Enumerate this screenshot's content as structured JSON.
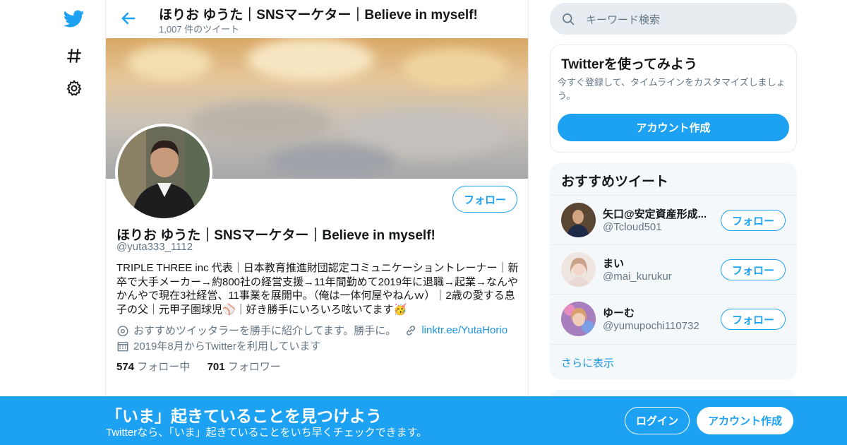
{
  "colors": {
    "brand": "#1da1f2",
    "link": "#1b95e0",
    "muted": "#657786",
    "border": "#e6ecf0"
  },
  "nav": {
    "icons": [
      "twitter-bird-icon",
      "hashtag-icon",
      "gear-icon"
    ]
  },
  "header": {
    "title": "ほりお ゆうた｜SNSマーケター｜Believe in myself!",
    "tweet_count": "1,007 件のツイート"
  },
  "profile": {
    "follow_label": "フォロー",
    "name": "ほりお ゆうた｜SNSマーケター｜Believe in myself!",
    "handle": "@yuta333_1112",
    "bio": "TRIPLE THREE inc 代表｜日本教育推進財団認定コミュニケーショントレーナー｜新卒で大手メーカー→約800社の経営支援→11年間勤めて2019年に退職→起業→なんやかんやで現在3社経営、11事業を展開中。（俺は一体何屋やねんｗ）｜2歳の愛する息子の父｜元甲子園球児⚾｜好き勝手にいろいろ呟いてます🥳",
    "location": "おすすめツイッタラーを勝手に紹介してます。勝手に。",
    "website": "linktr.ee/YutaHorio",
    "joined": "2019年8月からTwitterを利用しています",
    "following_count": "574",
    "following_label": "フォロー中",
    "followers_count": "701",
    "followers_label": "フォロワー"
  },
  "search": {
    "placeholder": "キーワード検索"
  },
  "try_twitter": {
    "title": "Twitterを使ってみよう",
    "text": "今すぐ登録して、タイムラインをカスタマイズしましょう。",
    "button": "アカウント作成"
  },
  "recommended": {
    "title": "おすすめツイート",
    "items": [
      {
        "name": "矢口@安定資産形成...",
        "handle": "@Tcloud501",
        "follow": "フォロー"
      },
      {
        "name": "まい",
        "handle": "@mai_kurukur",
        "follow": "フォロー"
      },
      {
        "name": "ゆーむ",
        "handle": "@yumupochi110732",
        "follow": "フォロー"
      }
    ],
    "more": "さらに表示"
  },
  "bottom_bar": {
    "title": "「いま」起きていることを見つけよう",
    "subtitle": "Twitterなら、「いま」起きていることをいち早くチェックできます。",
    "login": "ログイン",
    "signup": "アカウント作成"
  }
}
